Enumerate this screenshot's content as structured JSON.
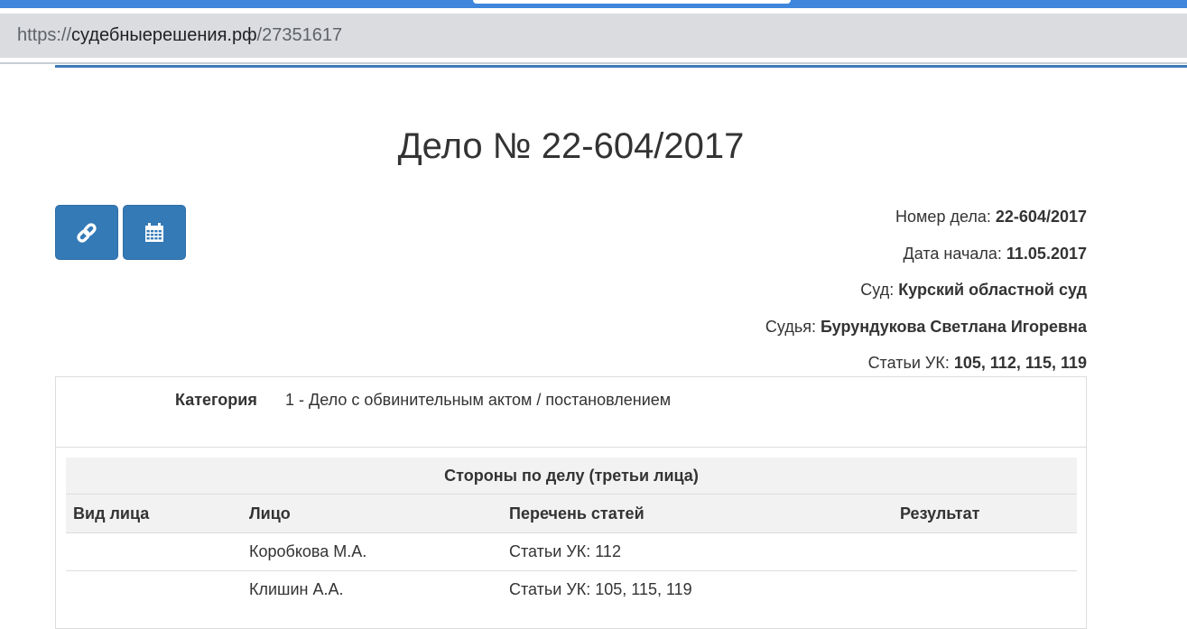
{
  "browser": {
    "url_scheme": "https://",
    "url_host": "судебныерешения.рф",
    "url_path": "/27351617"
  },
  "page": {
    "title": "Дело № 22-604/2017"
  },
  "actions": {
    "link_icon": "link-icon",
    "calendar_icon": "calendar-icon"
  },
  "case_info": {
    "number_label": "Номер дела:",
    "number_value": "22-604/2017",
    "start_label": "Дата начала:",
    "start_value": "11.05.2017",
    "court_label": "Суд:",
    "court_value": "Курский областной суд",
    "judge_label": "Судья:",
    "judge_value": "Бурундукова Светлана Игоревна",
    "articles_label": "Статьи УК:",
    "articles_value": "105, 112, 115, 119"
  },
  "category": {
    "label": "Категория",
    "value": "1 - Дело с обвинительным актом / постановлением"
  },
  "parties": {
    "caption": "Стороны по делу (третьи лица)",
    "columns": [
      "Вид лица",
      "Лицо",
      "Перечень статей",
      "Результат"
    ],
    "rows": [
      [
        "",
        "Коробкова М.А.",
        "Статьи УК: 112",
        ""
      ],
      [
        "",
        "Клишин А.А.",
        "Статьи УК: 105, 115, 119",
        ""
      ]
    ]
  },
  "colors": {
    "browser_accent": "#3f86dc",
    "button_primary": "#337ab7",
    "text": "#333333",
    "table_header_bg": "#f2f2f2"
  }
}
